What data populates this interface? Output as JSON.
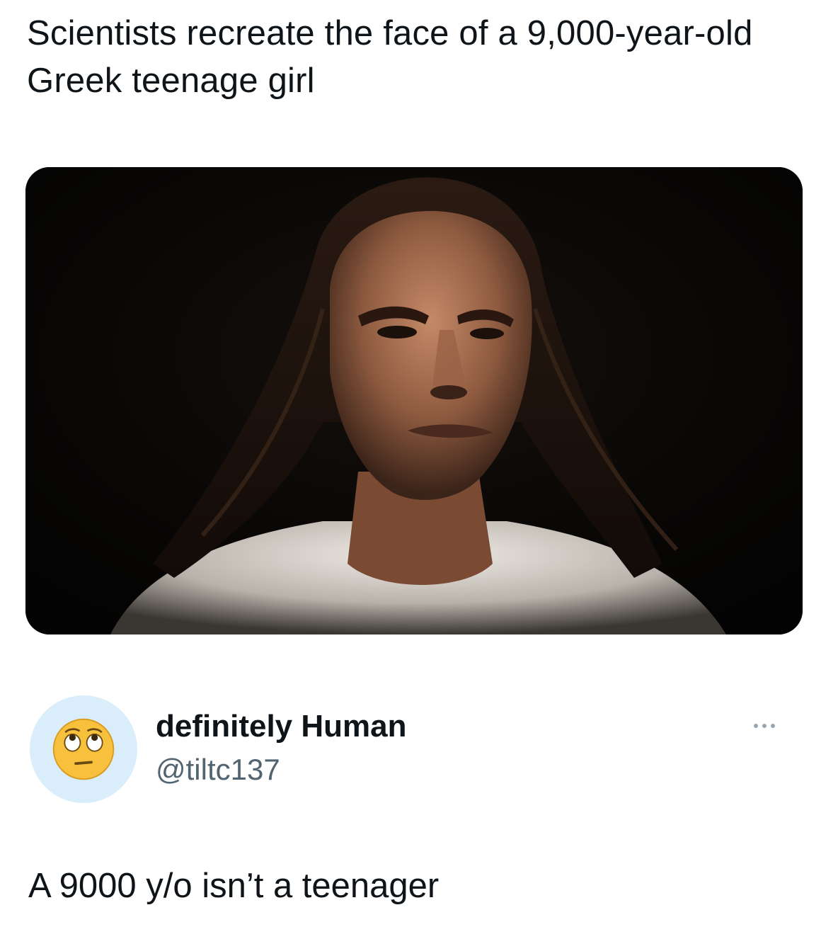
{
  "headline": {
    "text": "Scientists recreate the face of a 9,000-year-old Greek teenage girl"
  },
  "media": {
    "kind": "photo",
    "subject": "photo-of-reconstructed-face"
  },
  "reply": {
    "avatar_icon": "face-with-rolling-eyes-icon",
    "display_name": "definitely Human",
    "handle": "@tiltc137",
    "more_icon": "more-dots-icon",
    "text": "A 9000 y/o isn’t a teenager"
  },
  "colors": {
    "text_primary": "#0f1419",
    "text_secondary": "#536471",
    "avatar_bg": "#d9eefa"
  }
}
